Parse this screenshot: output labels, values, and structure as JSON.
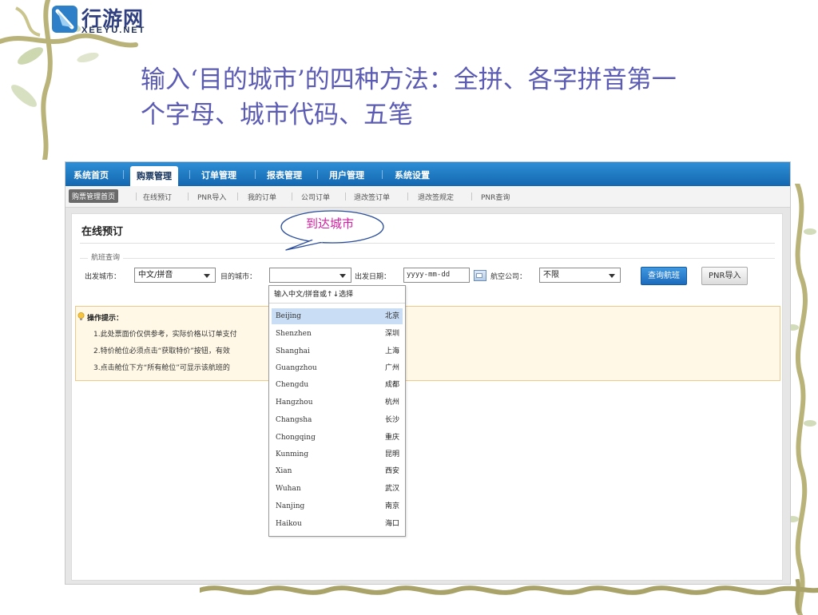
{
  "logo": {
    "cn": "行游网",
    "en": "XEEYU.NET"
  },
  "slide_title": "输入‘目的城市’的四种方法：全拼、各字拼音第一个字母、城市代码、五笔",
  "nav": {
    "tabs": [
      "系统首页",
      "购票管理",
      "订单管理",
      "报表管理",
      "用户管理",
      "系统设置"
    ],
    "active_tab": "购票管理"
  },
  "subnav": {
    "items": [
      "购票管理首页",
      "在线预订",
      "PNR导入",
      "我的订单",
      "公司订单",
      "退改签订单",
      "退改签规定",
      "PNR查询"
    ],
    "active": "购票管理首页"
  },
  "panel": {
    "title": "在线预订",
    "legend": "航班查询",
    "depart_city_label": "出发城市：",
    "depart_city_value": "中文/拼音",
    "dest_city_label": "目的城市：",
    "dest_city_value": "",
    "depart_date_label": "出发日期：",
    "depart_date_placeholder": "yyyy-mm-dd",
    "airline_label": "航空公司：",
    "airline_value": "不限",
    "search_button": "查询航班",
    "pnr_button": "PNR导入"
  },
  "tips": {
    "heading": "操作提示：",
    "items": [
      "1.此处票面价仅供参考，实际价格以订单支付",
      "2.特价舱位必须点击“获取特价”按钮，有效",
      "3.点击舱位下方“所有舱位”可显示该航班的"
    ]
  },
  "dropdown": {
    "hint": "输入中文/拼音或↑↓选择",
    "selected_index": 0,
    "cities": [
      {
        "pinyin": "Beijing",
        "name": "北京"
      },
      {
        "pinyin": "Shenzhen",
        "name": "深圳"
      },
      {
        "pinyin": "Shanghai",
        "name": "上海"
      },
      {
        "pinyin": "Guangzhou",
        "name": "广州"
      },
      {
        "pinyin": "Chengdu",
        "name": "成都"
      },
      {
        "pinyin": "Hangzhou",
        "name": "杭州"
      },
      {
        "pinyin": "Changsha",
        "name": "长沙"
      },
      {
        "pinyin": "Chongqing",
        "name": "重庆"
      },
      {
        "pinyin": "Kunming",
        "name": "昆明"
      },
      {
        "pinyin": "Xian",
        "name": "西安"
      },
      {
        "pinyin": "Wuhan",
        "name": "武汉"
      },
      {
        "pinyin": "Nanjing",
        "name": "南京"
      },
      {
        "pinyin": "Haikou",
        "name": "海口"
      }
    ]
  },
  "callout": "到达城市",
  "icons": {
    "logo": "paper-plane-logo-icon",
    "calendar": "calendar-icon",
    "tip": "lightbulb-icon",
    "dropdown": "chevron-down-icon"
  },
  "colors": {
    "nav_bar": "#1d78c4",
    "title_text": "#5b5bb4",
    "callout_text": "#d01fa0",
    "tips_bg": "#fff8e6",
    "selected_row": "#c9def5"
  }
}
